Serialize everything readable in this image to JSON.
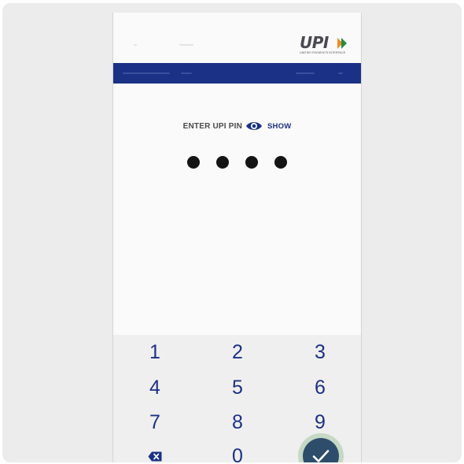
{
  "header": {
    "logo": {
      "text": "UPI",
      "tagline": "Unified Payments Interface"
    },
    "bar_color": "#1b3186"
  },
  "pin_entry": {
    "label": "ENTER UPI PIN",
    "show_label": "SHOW",
    "visibility_icon": "eye-icon",
    "entered_digits_masked": 4
  },
  "keypad": {
    "keys": [
      "1",
      "2",
      "3",
      "4",
      "5",
      "6",
      "7",
      "8",
      "9",
      "0"
    ],
    "backspace_icon": "backspace-icon",
    "submit_icon": "check-icon",
    "accent_color": "#1b3186",
    "submit_color": "#2e4d6b"
  }
}
